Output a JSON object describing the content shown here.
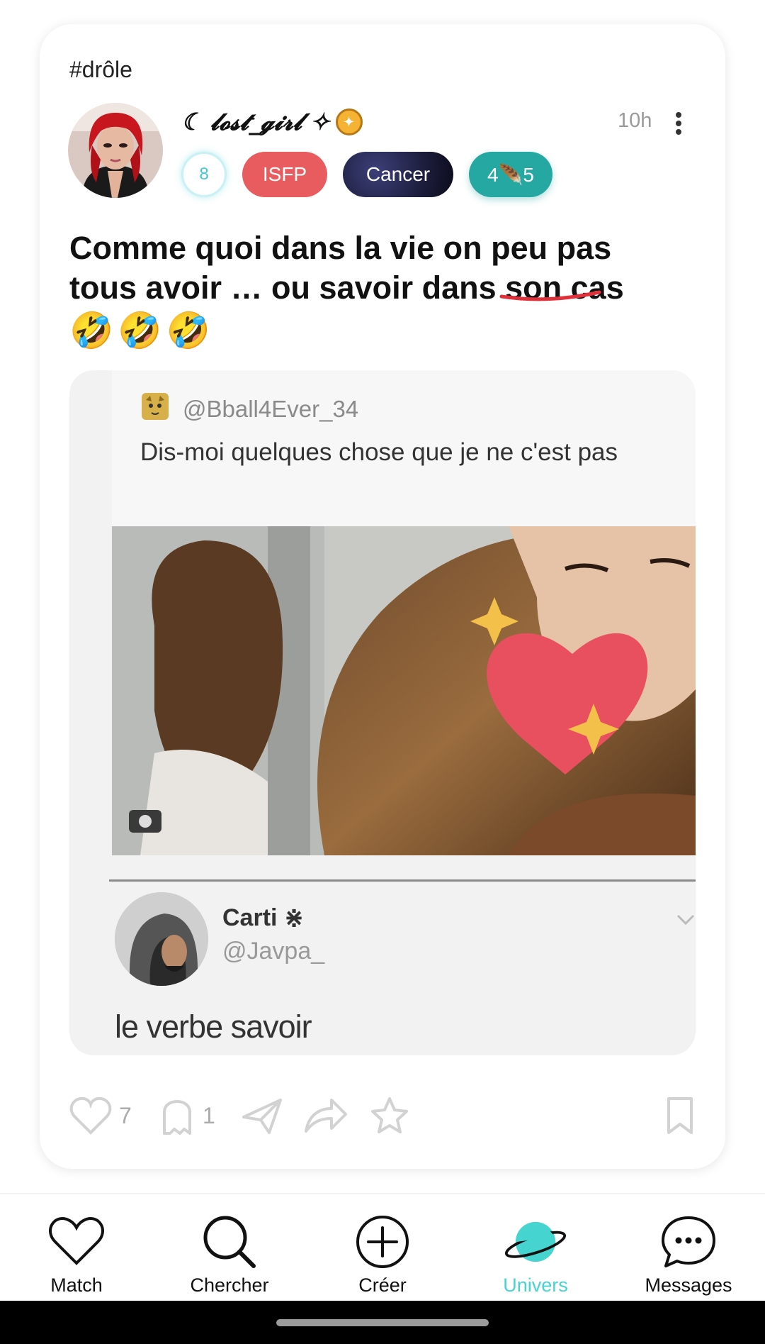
{
  "post": {
    "hashtag": "#drôle",
    "username": "☾ 𝓵𝓸𝓼𝓽_𝓰𝓲𝓻𝓵 ✧",
    "time": "10h",
    "badges": {
      "number": "8",
      "mbti": "ISFP",
      "zodiac": "Cancer",
      "rating": "4🪶5"
    },
    "title_line1": "Comme quoi dans la vie on peu pas",
    "title_line2": "tous avoir … ou savoir dans son cas",
    "emojis": "🤣🤣🤣",
    "meme": {
      "tweet_handle": "@Bball4Ever_34",
      "tweet_text": "Dis-moi quelques chose que je ne c'est pas",
      "reply_name": "Carti ⋇",
      "reply_handle": "@Javpa_",
      "reply_text": "le verbe savoir"
    },
    "actions": {
      "likes": "7",
      "comments": "1"
    }
  },
  "nav": {
    "match": "Match",
    "search": "Chercher",
    "create": "Créer",
    "universe": "Univers",
    "messages": "Messages"
  },
  "colors": {
    "accent": "#45d4d0",
    "mbti_pill": "#e85c5f",
    "rating_pill": "#25a7a2"
  }
}
